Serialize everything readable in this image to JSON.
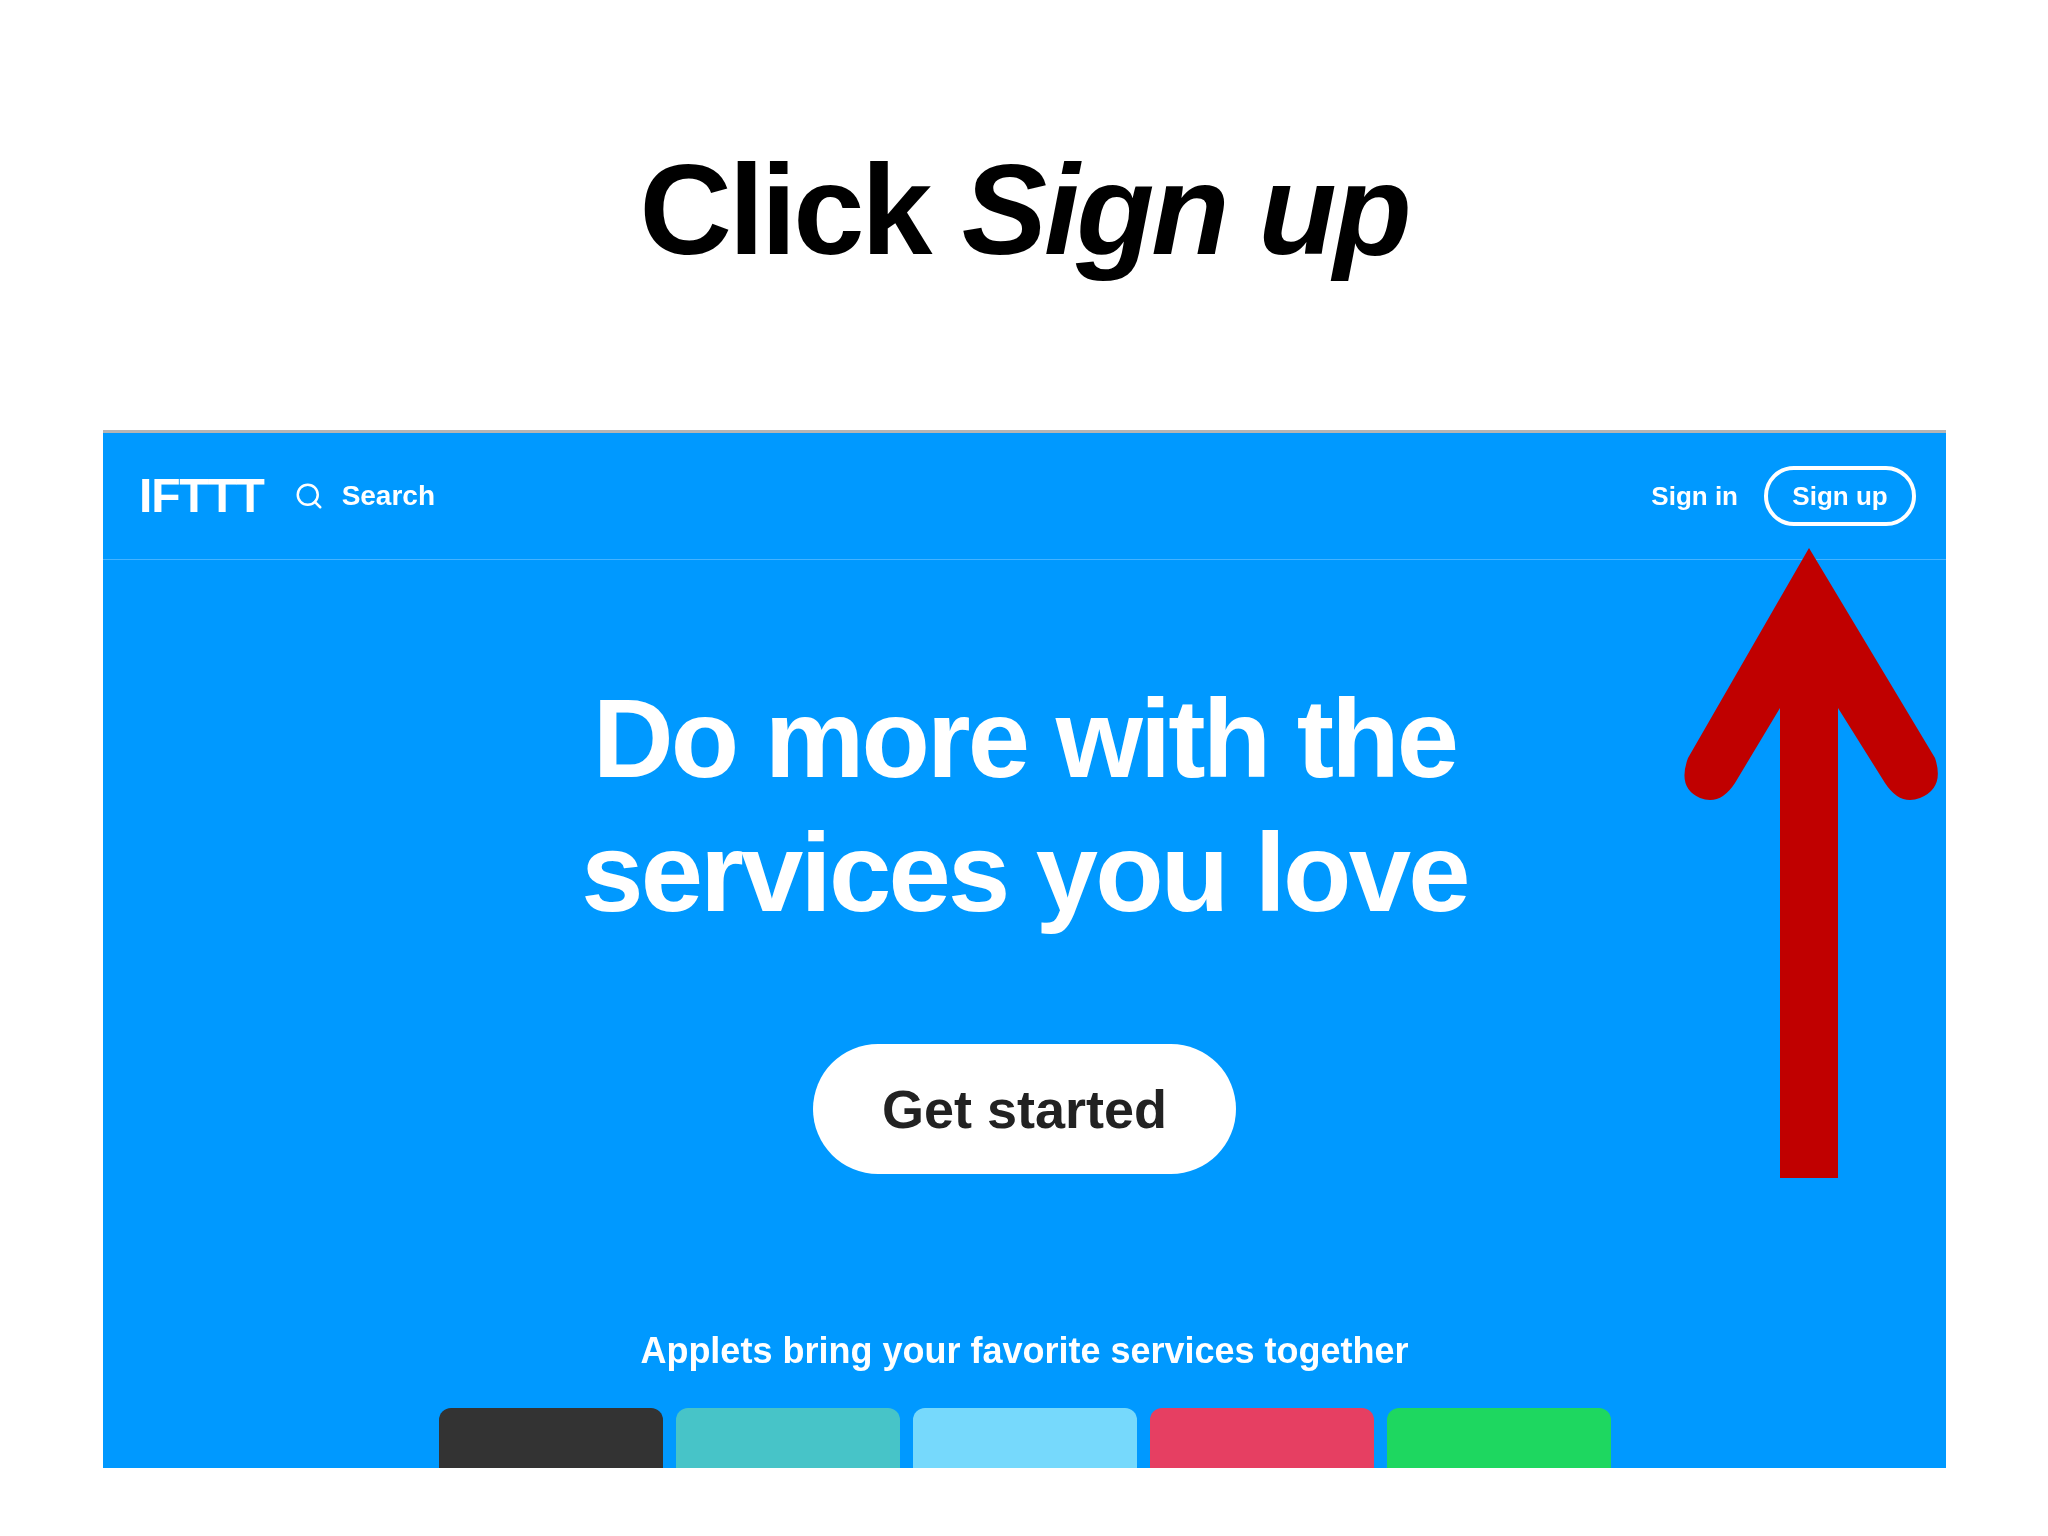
{
  "slide_title": "Click *Sign up*",
  "nav": {
    "logo": "IFTTT",
    "search": "Search",
    "sign_in": "Sign in",
    "sign_up": "Sign up"
  },
  "hero": {
    "headline": "Do more with the services you love",
    "button": "Get started"
  },
  "applets": {
    "heading": "Applets bring your favorite services together",
    "cards": [
      {
        "color": "#333333"
      },
      {
        "color": "#47c4c8"
      },
      {
        "color": "#76d9fc"
      },
      {
        "color": "#e63f62"
      },
      {
        "color": "#1ed760"
      }
    ]
  },
  "annotation": {
    "kind": "arrow"
  }
}
